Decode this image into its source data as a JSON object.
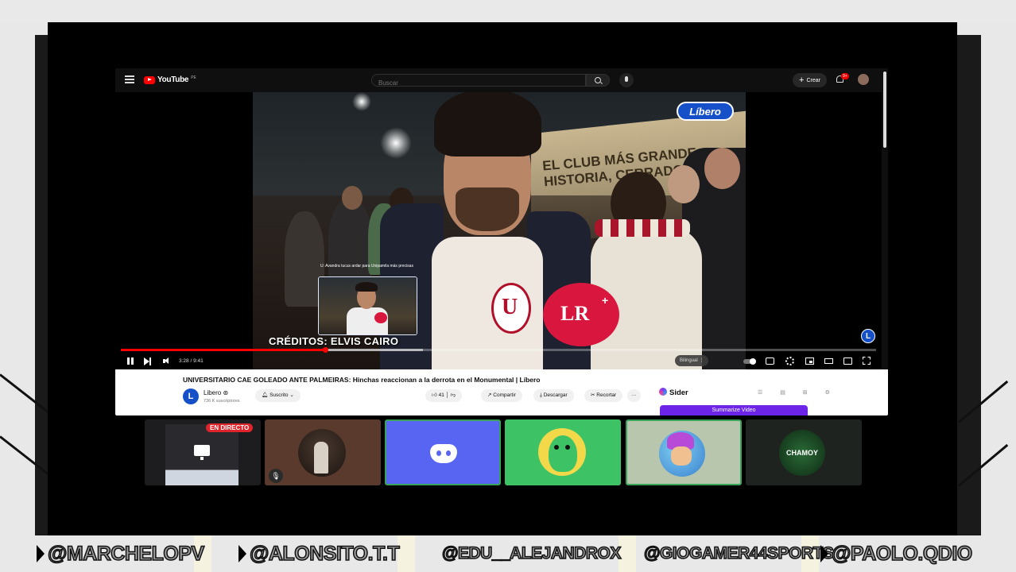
{
  "youtube": {
    "logo_text": "YouTube",
    "logo_superscript": "PE",
    "search_placeholder": "Buscar",
    "create_label": "Crear",
    "notification_count": "9+",
    "video": {
      "watermark_logo": "Líbero",
      "background_sign": "EL CLUB MÁS GRANDE",
      "background_sign_2": "HISTORIA, CERRADO",
      "pip_caption": "U: Avandra tucus ardar para Unipamila más precisas",
      "credits": "CRÉDITOS: ELVIS CAIRO",
      "mic_label": "LR",
      "mic_plus": "+",
      "shirt_logo": "U",
      "corner_logo": "L",
      "time": "3:28 / 9:41",
      "progress_fraction": 0.27,
      "buffer_fraction": 0.13,
      "subtitle_language": "Bilingual"
    },
    "info": {
      "title": "UNIVERSITARIO CAE GOLEADO ANTE PALMEIRAS: Hinchas reaccionan a la derrota en el Monumental | Líbero",
      "channel_initial": "L",
      "channel_name": "Libero ⊛",
      "subscribers": "736 K suscriptores",
      "subscribe_label": "Suscrito ⌄",
      "likes": "41",
      "share_label": "Compartir",
      "download_label": "Descargar",
      "clip_label": "Recortar",
      "more_label": "···",
      "sider_label": "Sider",
      "sider_icons": "☰ ▤ ⊞ ⚙",
      "summarize_label": "Summarize Video"
    }
  },
  "participants": {
    "live_badge": "EN DIRECTO",
    "mic_muted_icon": "🎙",
    "chamoy_name": "CHAMOY"
  },
  "names": [
    "@MARCHELOPV",
    "@ALONSITO.T.T",
    "@EDU__ALEJANDROX",
    "@GIOGAMER44SPORTS",
    "@PAOLO.QDIO"
  ],
  "colors": {
    "youtube_red": "#ff0000",
    "libero_blue": "#1550c9",
    "lr_red": "#d8163e",
    "discord": "#5865f2",
    "sider_purple": "#6b24e8",
    "live_red": "#e0242c"
  }
}
